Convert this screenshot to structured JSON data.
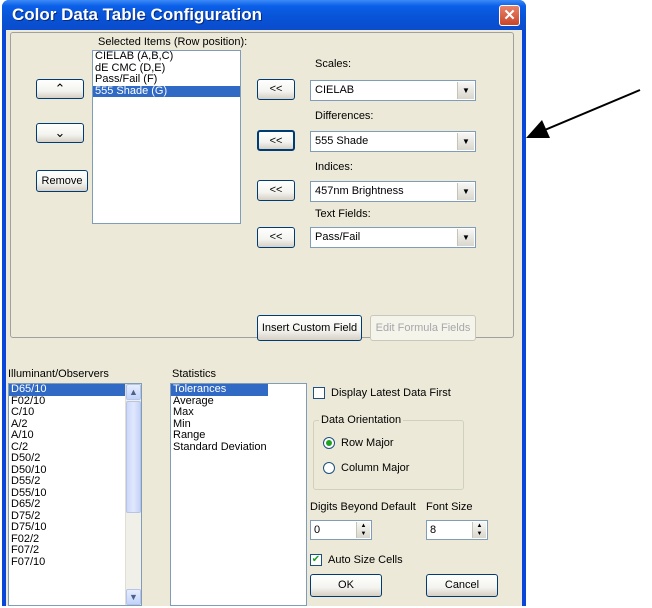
{
  "window": {
    "title": "Color Data Table Configuration",
    "close_label": "✕"
  },
  "selected_items": {
    "label": "Selected Items (Row position):",
    "items": [
      "CIELAB (A,B,C)",
      "dE CMC (D,E)",
      "Pass/Fail (F)",
      "555 Shade (G)"
    ],
    "selected_index": 3
  },
  "row_buttons": {
    "up": "⌃",
    "down": "⌄",
    "remove": "Remove"
  },
  "add_buttons": {
    "label": "<<"
  },
  "scales": {
    "label": "Scales:",
    "value": "CIELAB"
  },
  "differences": {
    "label": "Differences:",
    "value": "555 Shade"
  },
  "indices": {
    "label": "Indices:",
    "value": "457nm Brightness"
  },
  "text_fields": {
    "label": "Text Fields:",
    "value": "Pass/Fail"
  },
  "insert_custom_field": "Insert Custom Field",
  "edit_formula_fields": "Edit Formula Fields",
  "illuminants": {
    "label": "Illuminant/Observers",
    "items": [
      "D65/10",
      "F02/10",
      "C/10",
      "A/2",
      "A/10",
      "C/2",
      "D50/2",
      "D50/10",
      "D55/2",
      "D55/10",
      "D65/2",
      "D75/2",
      "D75/10",
      "F02/2",
      "F07/2",
      "F07/10"
    ]
  },
  "statistics": {
    "label": "Statistics",
    "items": [
      "Tolerances",
      "Average",
      "Max",
      "Min",
      "Range",
      "Standard Deviation"
    ]
  },
  "display_latest": {
    "label": "Display Latest Data First",
    "checked": false
  },
  "orientation": {
    "label": "Data Orientation",
    "row_major": "Row Major",
    "column_major": "Column Major",
    "selected": "Row Major"
  },
  "digits": {
    "label": "Digits Beyond Default",
    "value": "0"
  },
  "font_size": {
    "label": "Font Size",
    "value": "8"
  },
  "auto_size": {
    "label": "Auto Size Cells",
    "checked": true,
    "mark": "✔"
  },
  "ok": "OK",
  "cancel": "Cancel",
  "colors": {
    "title_bar": "#0a5fe8",
    "selection": "#316ac5",
    "dialog_bg": "#ece9d8",
    "close_button": "#d0553a"
  }
}
